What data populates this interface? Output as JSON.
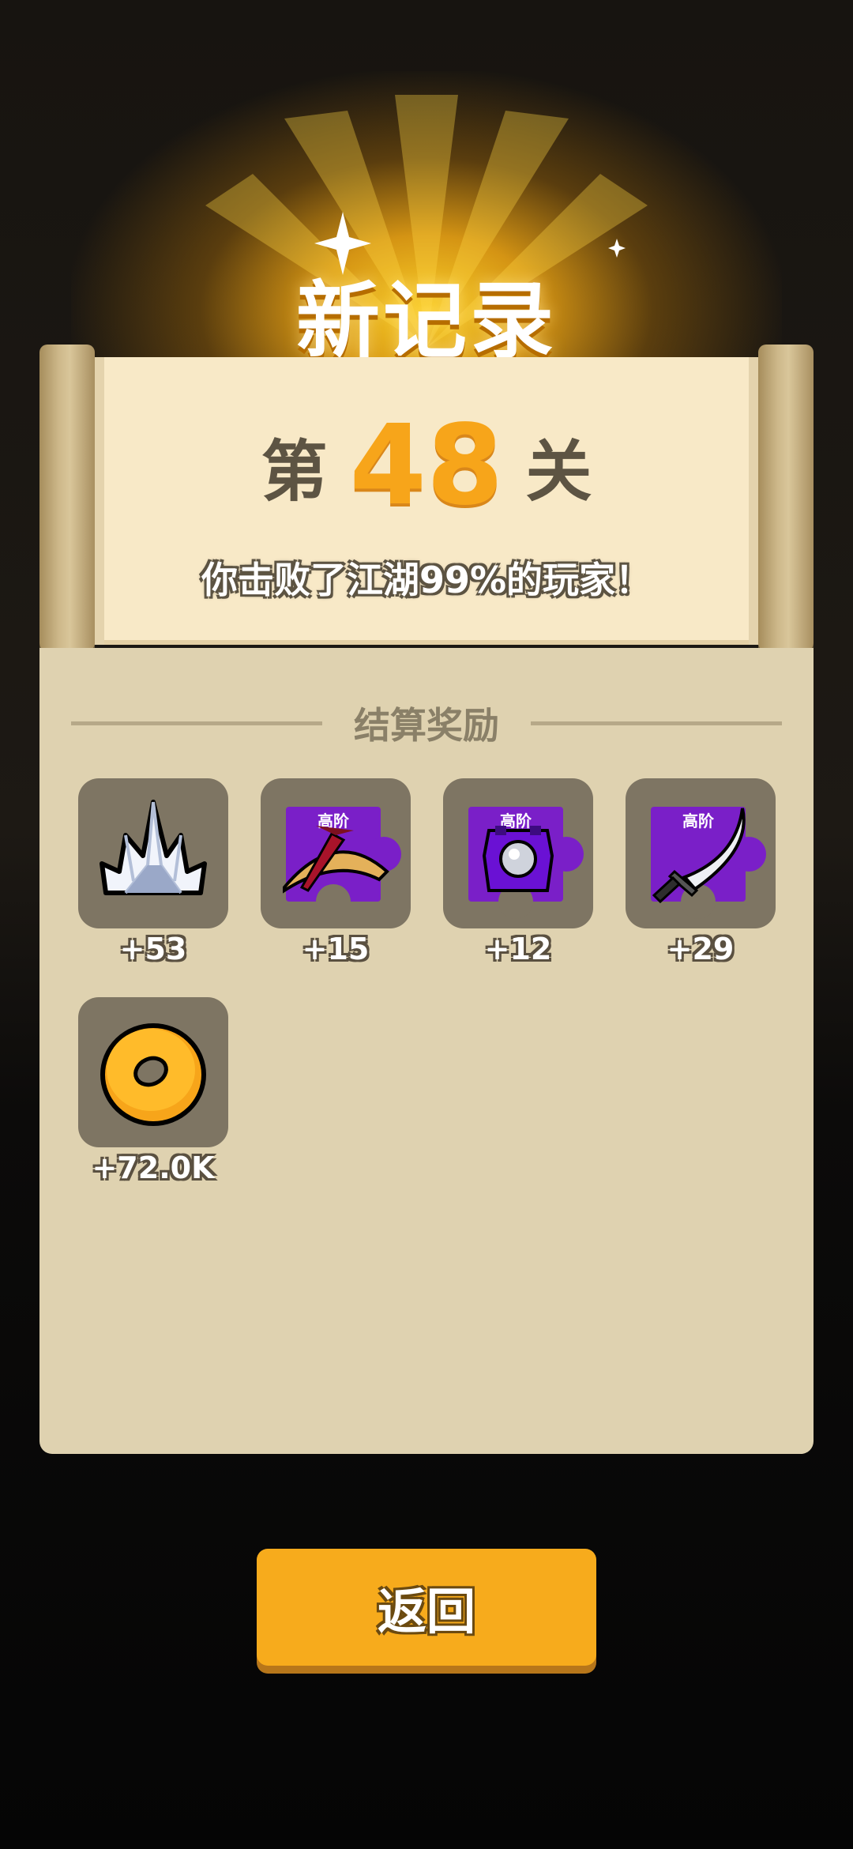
{
  "header": {
    "title": "新记录"
  },
  "level": {
    "prefix": "第",
    "number": "48",
    "suffix": "关"
  },
  "summary": {
    "text": "你击败了江湖99%的玩家！"
  },
  "rewards_panel": {
    "title": "结算奖励",
    "items": [
      {
        "icon": "crystal-icon",
        "tier": "",
        "quantity": "+53"
      },
      {
        "icon": "straw-hat-fragment-icon",
        "tier": "高阶",
        "quantity": "+15"
      },
      {
        "icon": "armor-fragment-icon",
        "tier": "高阶",
        "quantity": "+12"
      },
      {
        "icon": "sabre-fragment-icon",
        "tier": "高阶",
        "quantity": "+29"
      },
      {
        "icon": "gold-coin-icon",
        "tier": "",
        "quantity": "+72.0K"
      }
    ]
  },
  "actions": {
    "back_label": "返回"
  },
  "colors": {
    "accent": "#f7ab1c",
    "level_number": "#f7a51a",
    "puzzle_purple": "#7a1fc8",
    "panel": "#dfd2b0",
    "paper": "#f8e9c7"
  }
}
